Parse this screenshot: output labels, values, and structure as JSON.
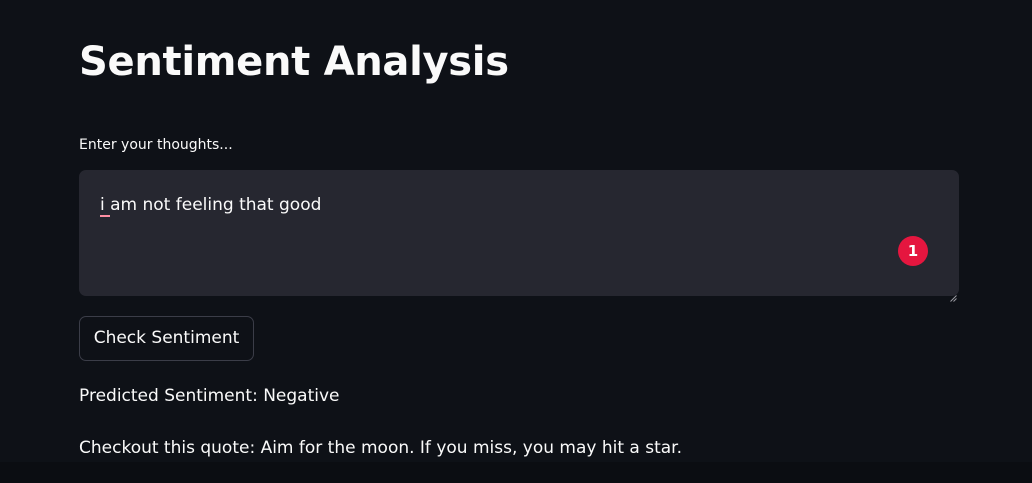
{
  "app": {
    "title": "Sentiment Analysis"
  },
  "input": {
    "label": "Enter your thoughts...",
    "value": "i am not feeling that good",
    "grammar_issue_count": "1"
  },
  "actions": {
    "check_label": "Check Sentiment"
  },
  "output": {
    "prediction": "Predicted Sentiment: Negative",
    "quote": "Checkout this quote: Aim for the moon. If you miss, you may hit a star."
  },
  "colors": {
    "background": "#0e1117",
    "input_background": "#262730",
    "text": "#fafafa",
    "badge": "#e5163f",
    "spell_underline": "#ff8fa3"
  },
  "icons": {
    "resize": "resize-grip-icon",
    "grammar": "grammar-badge-icon"
  }
}
